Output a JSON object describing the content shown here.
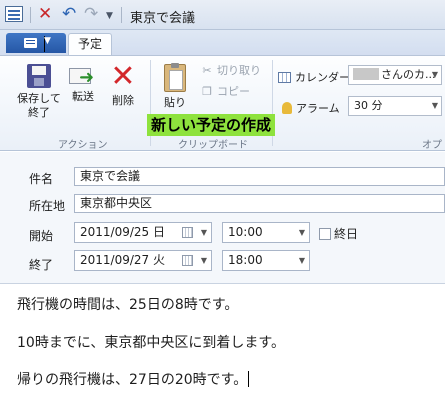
{
  "window": {
    "title": "東京で会議",
    "qat_icons": [
      "app-icon",
      "delete-icon",
      "undo-icon",
      "redo-icon",
      "qat-dropdown-icon"
    ]
  },
  "tabs": {
    "file_icon": "file-menu-icon",
    "active_label": "予定"
  },
  "ribbon": {
    "actions": {
      "save_close_line1": "保存して",
      "save_close_line2": "終了",
      "forward": "転送",
      "delete": "削除",
      "group_label": "アクション"
    },
    "clipboard": {
      "paste": "貼り",
      "cut": "切り取り",
      "copy": "コピー",
      "group_label": "クリップボード"
    },
    "options": {
      "calendar_label": "カレンダー",
      "calendar_value_suffix": "さんのカ...",
      "alarm_label": "アラーム",
      "alarm_value": "30 分",
      "group_label_partial": "オプシ"
    }
  },
  "annotation": {
    "text": "新しい予定の作成",
    "color": "#8ee23d"
  },
  "form": {
    "subject_label": "件名",
    "subject_value": "東京で会議",
    "location_label": "所在地",
    "location_value": "東京都中央区",
    "start_label": "開始",
    "start_date": "2011/09/25 日",
    "start_time": "10:00",
    "allday_label": "終日",
    "allday_checked": false,
    "end_label": "終了",
    "end_date": "2011/09/27 火",
    "end_time": "18:00"
  },
  "body": {
    "line1": "飛行機の時間は、25日の8時です。",
    "line2": "10時までに、東京都中央区に到着します。",
    "line3": "帰りの飛行機は、27日の20時です。"
  }
}
